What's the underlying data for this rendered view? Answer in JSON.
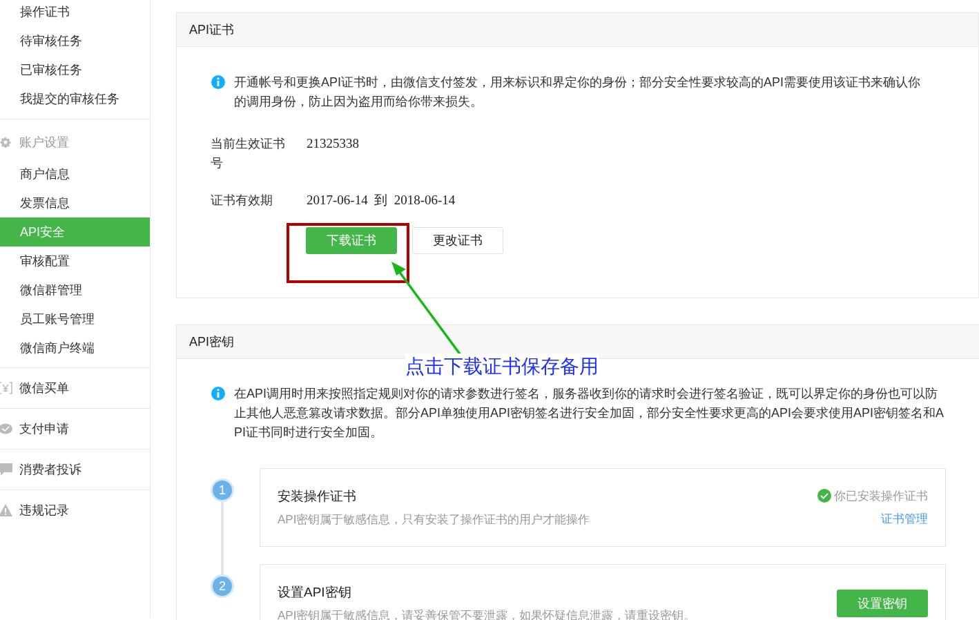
{
  "sidebar": {
    "sections": [
      {
        "kind": "list",
        "items": [
          {
            "label": "操作证书",
            "selected": false
          },
          {
            "label": "待审核任务",
            "selected": false
          },
          {
            "label": "已审核任务",
            "selected": false
          },
          {
            "label": "我提交的审核任务",
            "selected": false
          }
        ]
      },
      {
        "kind": "group",
        "title": "账户设置",
        "items": [
          {
            "label": "商户信息",
            "selected": false
          },
          {
            "label": "发票信息",
            "selected": false
          },
          {
            "label": "API安全",
            "selected": true
          },
          {
            "label": "审核配置",
            "selected": false
          },
          {
            "label": "微信群管理",
            "selected": false
          },
          {
            "label": "员工账号管理",
            "selected": false
          },
          {
            "label": "微信商户终端",
            "selected": false
          }
        ]
      },
      {
        "kind": "link",
        "title": "微信买单"
      },
      {
        "kind": "link",
        "title": "支付申请"
      },
      {
        "kind": "link",
        "title": "消费者投诉"
      },
      {
        "kind": "link",
        "title": "违规记录"
      }
    ]
  },
  "cert_panel": {
    "title": "API证书",
    "info": "开通帐号和更换API证书时，由微信支付签发，用来标识和界定你的身份；部分安全性要求较高的API需要使用该证书来确认你的调用身份，防止因为盗用而给你带来损失。",
    "fields": [
      {
        "label": "当前生效证书号",
        "value": "21325338"
      },
      {
        "label": "证书有效期",
        "value": "2017-06-14  到  2018-06-14"
      }
    ],
    "buttons": [
      {
        "label": "下载证书",
        "kind": "primary"
      },
      {
        "label": "更改证书",
        "kind": "secondary"
      }
    ]
  },
  "key_panel": {
    "title": "API密钥",
    "info": "在API调用时用来按照指定规则对你的请求参数进行签名，服务器收到你的请求时会进行签名验证，既可以界定你的身份也可以防止其他人恶意篡改请求数据。部分API单独使用API密钥签名进行安全加固，部分安全性要求更高的API会要求使用API密钥签名和API证书同时进行安全加固。",
    "steps": [
      {
        "number": "1",
        "title": "安装操作证书",
        "description": "API密钥属于敏感信息，只有安装了操作证书的用户才能操作",
        "kind": "status",
        "status": "你已安装操作证书",
        "link": "证书管理"
      },
      {
        "number": "2",
        "title": "设置API密钥",
        "description": "API密钥属于敏感信息，请妥善保管不要泄露，如果怀疑信息泄露，请重设密钥。",
        "kind": "action",
        "button": "设置密钥"
      }
    ]
  },
  "annotation": {
    "callout": "点击下载证书保存备用"
  }
}
